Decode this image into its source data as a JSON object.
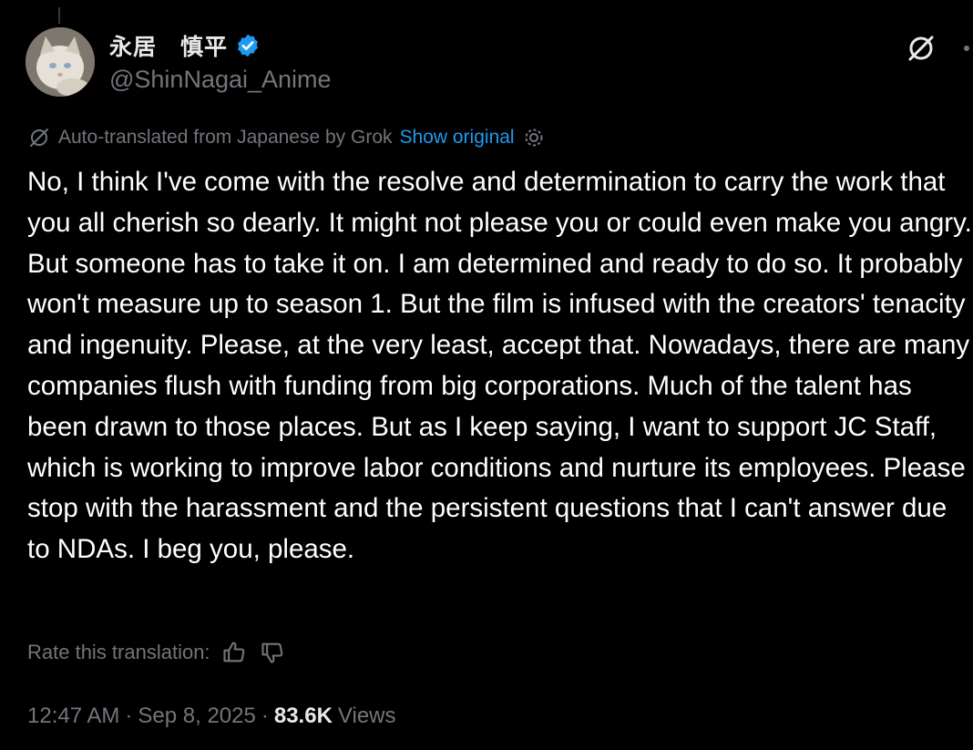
{
  "author": {
    "display_name": "永居　慎平",
    "handle": "@ShinNagai_Anime",
    "verified": true
  },
  "translation": {
    "note": "Auto-translated from Japanese by Grok",
    "show_original_label": "Show original",
    "icons": [
      "grok-icon",
      "settings-gear-icon"
    ]
  },
  "tweet": {
    "text": "No, I think I've come with the resolve and determination to carry the work that you all cherish so dearly. It might not please you or could even make you angry. But someone has to take it on. I am determined and ready to do so. It probably won't measure up to season 1. But the film is infused with the creators' tenacity and ingenuity. Please, at the very least, accept that. Nowadays, there are many companies flush with funding from big corporations. Much of the talent has been drawn to those places. But as I keep saying, I want to support JC Staff, which is working to improve labor conditions and nurture its employees. Please stop with the harassment and the persistent questions that I can't answer due to NDAs. I beg you, please."
  },
  "rating": {
    "label": "Rate this translation:",
    "icons": [
      "thumbs-up-icon",
      "thumbs-down-icon"
    ]
  },
  "meta": {
    "time": "12:47 AM",
    "separator": "·",
    "date": "Sep 8, 2025",
    "views_count": "83.6K",
    "views_label": "Views"
  },
  "colors": {
    "background": "#000000",
    "text": "#ffffff",
    "muted": "#71767b",
    "accent": "#1d9bf0"
  }
}
